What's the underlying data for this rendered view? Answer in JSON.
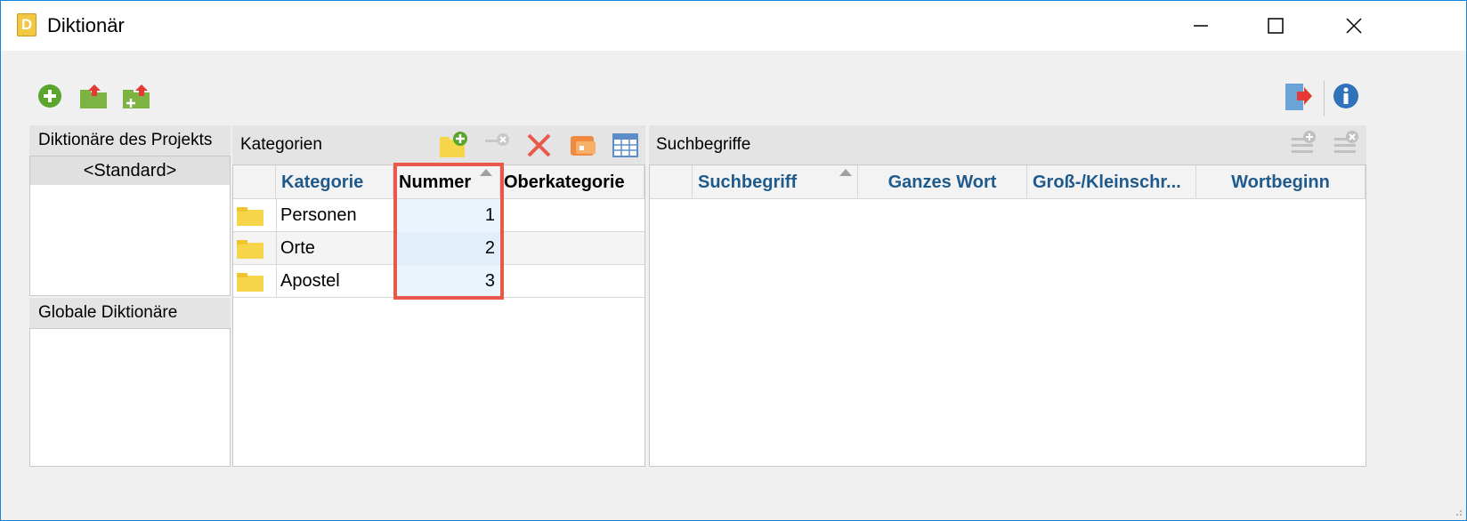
{
  "window": {
    "title": "Diktionär",
    "app_icon_letter": "D"
  },
  "toolbar": {
    "left_icons": [
      "add-circle-icon",
      "export-folder-icon",
      "import-folder-icon"
    ],
    "right_icons": [
      "exit-door-icon",
      "info-icon"
    ]
  },
  "dictionaries": {
    "project_header": "Diktionäre des Projekts",
    "project_items": [
      "<Standard>"
    ],
    "global_header": "Globale Diktionäre",
    "global_items": []
  },
  "categories": {
    "header": "Kategorien",
    "toolbar_icons": [
      "new-folder-icon",
      "remove-disabled-icon",
      "delete-icon",
      "move-category-icon",
      "grid-table-icon"
    ],
    "columns": [
      "Kategorie",
      "Nummer",
      "Oberkategorie"
    ],
    "sorted_column": "Nummer",
    "rows": [
      {
        "kategorie": "Personen",
        "nummer": "1",
        "oberkategorie": ""
      },
      {
        "kategorie": "Orte",
        "nummer": "2",
        "oberkategorie": ""
      },
      {
        "kategorie": "Apostel",
        "nummer": "3",
        "oberkategorie": ""
      }
    ]
  },
  "search_terms": {
    "header": "Suchbegriffe",
    "toolbar_icons": [
      "add-term-icon",
      "remove-term-icon"
    ],
    "columns": [
      "Suchbegriff",
      "Ganzes Wort",
      "Groß-/Kleinschr...",
      "Wortbeginn"
    ],
    "rows": []
  },
  "colors": {
    "accent_border": "#1883d7",
    "header_text": "#1f5a8c",
    "highlight": "#e8594a",
    "folder": "#f7d54a"
  }
}
